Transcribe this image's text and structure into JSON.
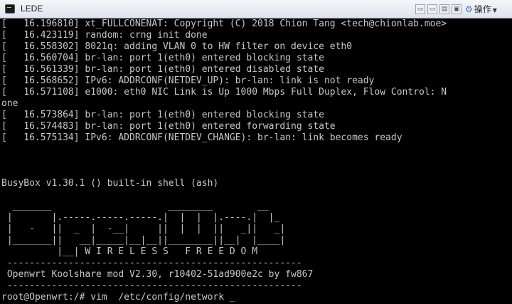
{
  "window": {
    "title": "LEDE",
    "menu_label": "操作",
    "menu_arrow": "▼"
  },
  "console": {
    "lines": [
      "[   16.196810] xt_FULLCONENAT: Copyright (C) 2018 Chion Tang <tech@chionlab.moe>",
      "[   16.423119] random: crng init done",
      "[   16.558302] 8021q: adding VLAN 0 to HW filter on device eth0",
      "[   16.560704] br-lan: port 1(eth0) entered blocking state",
      "[   16.561339] br-lan: port 1(eth0) entered disabled state",
      "[   16.568652] IPv6: ADDRCONF(NETDEV_UP): br-lan: link is not ready",
      "[   16.571108] e1000: eth0 NIC Link is Up 1000 Mbps Full Duplex, Flow Control: N",
      "one",
      "[   16.573864] br-lan: port 1(eth0) entered blocking state",
      "[   16.574483] br-lan: port 1(eth0) entered forwarding state",
      "[   16.575134] IPv6: ADDRCONF(NETDEV_CHANGE): br-lan: link becomes ready",
      "",
      "",
      "",
      "BusyBox v1.30.1 () built-in shell (ash)",
      "",
      "  _______                     ________        __",
      " |       |.-----.-----.-----.|  |  |  |.----.|  |_",
      " |   -   ||  _  |  -__|     ||  |  |  ||   _||   _|",
      " |_______||   __|_____|__|__||________||__|  |____|",
      "          |__| W I R E L E S S   F R E E D O M",
      " -----------------------------------------------------",
      " Openwrt Koolshare mod V2.30, r10402-51ad900e2c by fw867",
      " -----------------------------------------------------",
      "root@Openwrt:/# vim  /etc/config/network "
    ],
    "cursor": "_"
  }
}
